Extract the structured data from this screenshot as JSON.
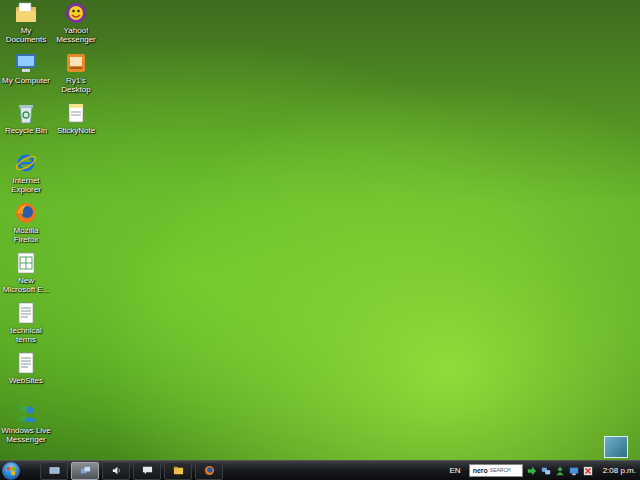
{
  "desktop": {
    "icons": [
      {
        "label": "My Documents",
        "kind": "documents"
      },
      {
        "label": "My Computer",
        "kind": "computer"
      },
      {
        "label": "Recycle Bin",
        "kind": "recycle"
      },
      {
        "label": "Internet Explorer",
        "kind": "ie"
      },
      {
        "label": "Mozilla Firefox",
        "kind": "firefox"
      },
      {
        "label": "New Microsoft E...",
        "kind": "excel"
      },
      {
        "label": "technical terms",
        "kind": "text"
      },
      {
        "label": "WebSites",
        "kind": "text"
      },
      {
        "label": "Windows Live Messenger",
        "kind": "messenger"
      },
      {
        "label": "Yahoo! Messenger",
        "kind": "yahoo"
      },
      {
        "label": "Ry1's Desktop",
        "kind": "folder"
      },
      {
        "label": "StickyNote",
        "kind": "sticky"
      }
    ]
  },
  "taskbar": {
    "buttons": [
      {
        "kind": "showdesktop",
        "selected": false
      },
      {
        "kind": "flip",
        "selected": true
      },
      {
        "kind": "volume",
        "selected": false
      },
      {
        "kind": "chat",
        "selected": false
      },
      {
        "kind": "folder",
        "selected": false
      },
      {
        "kind": "firefox",
        "selected": false
      }
    ],
    "language": "EN",
    "search": {
      "logo": "nero",
      "sublabel": "SEARCH"
    },
    "clock": "2:08 p.m."
  }
}
